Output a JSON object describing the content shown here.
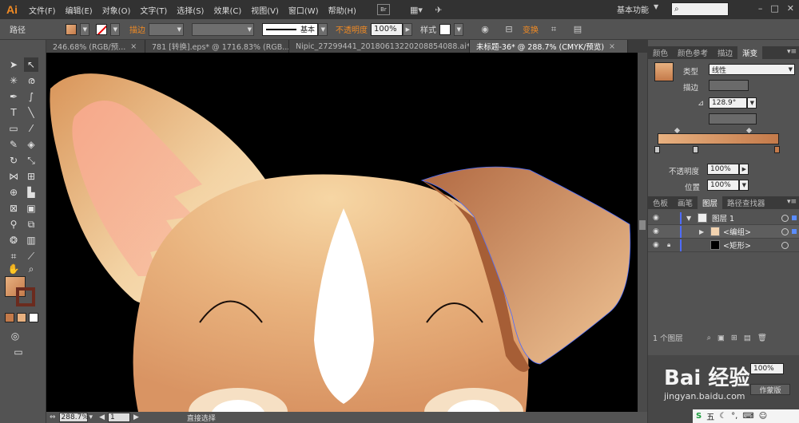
{
  "app": {
    "logo": "Ai"
  },
  "menu": [
    "文件(F)",
    "编辑(E)",
    "对象(O)",
    "文字(T)",
    "选择(S)",
    "效果(C)",
    "视图(V)",
    "窗口(W)",
    "帮助(H)"
  ],
  "workspace": {
    "label": "基本功能"
  },
  "control_bar": {
    "selection": "路径",
    "stroke_label": "描边",
    "stroke_style": "基本",
    "opacity_label": "不透明度",
    "opacity_value": "100%",
    "style_label": "样式",
    "transform_label": "变换"
  },
  "doc_tabs": [
    "246.68% (RGB/预...",
    "781 [转换].eps* @ 1716.83% (RGB...",
    "Nipic_27299441_20180613220208854088.ai*...",
    "未标题-36* @ 288.7% (CMYK/预览)"
  ],
  "panels": {
    "top_tabs": [
      "颜色",
      "颜色参考",
      "描边",
      "渐变"
    ],
    "type_label": "类型",
    "type_value": "线性",
    "stroke_label": "描边",
    "angle_value": "128.9°",
    "opacity_label": "不透明度",
    "opacity_value": "100%",
    "position_label": "位置",
    "position_value": "100%",
    "mid_tabs": [
      "色板",
      "画笔",
      "图层",
      "路径查找器"
    ],
    "layers": [
      {
        "name": "图层 1"
      },
      {
        "name": "<编组>"
      },
      {
        "name": "<矩形>"
      }
    ],
    "layer_count": "1 个图层",
    "bottom_value": "100%",
    "bottom_button": "作蒙版"
  },
  "watermark": {
    "text": "Bai  经验",
    "url": "jingyan.baidu.com"
  },
  "status": {
    "zoom": "288.7%",
    "artboard": "1",
    "tool": "直接选择"
  },
  "tray": {
    "ime": "五"
  }
}
